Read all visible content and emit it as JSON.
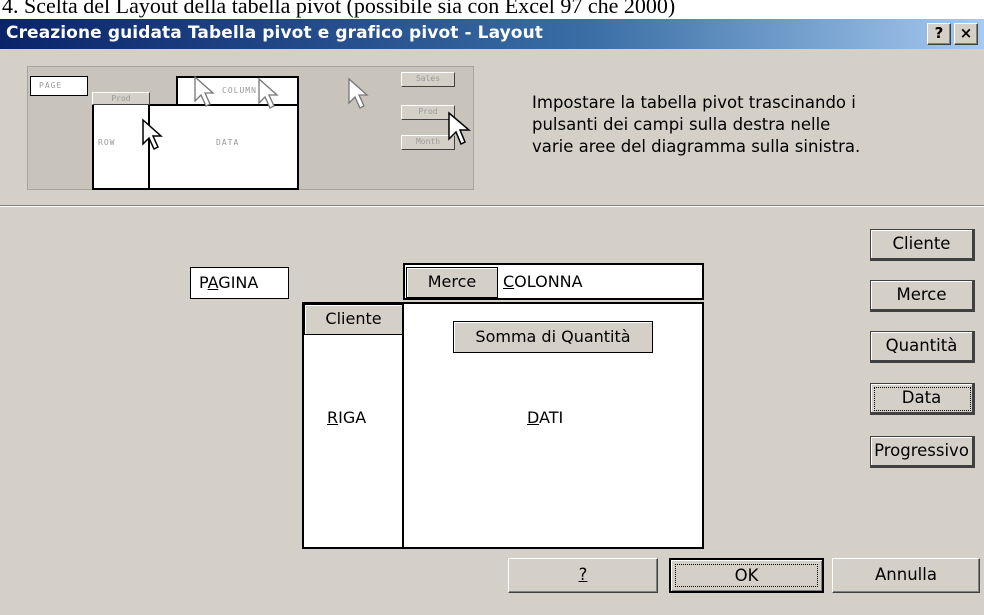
{
  "doc_caption": "4.  Scelta del Layout della tabella pivot (possibile sia con Excel 97 che 2000)",
  "dialog": {
    "title": "Creazione guidata Tabella pivot e grafico pivot - Layout",
    "help_button": "?",
    "close_button": "×"
  },
  "preview": {
    "page": "PAGE",
    "column": "COLUMN",
    "row": "ROW",
    "data": "DATA",
    "prod_drag": "Prod",
    "buttons": [
      "Sales",
      "Prod",
      "Month"
    ]
  },
  "instructions": [
    "Impostare la tabella pivot trascinando i",
    "pulsanti dei campi sulla destra nelle",
    "varie aree del diagramma sulla sinistra."
  ],
  "layout": {
    "page_pre": "P",
    "page_key": "A",
    "page_post": "GINA",
    "column_key": "C",
    "column_post": "OLONNA",
    "row_key": "R",
    "row_post": "IGA",
    "data_key": "D",
    "data_post": "ATI",
    "column_field": "Merce",
    "row_field": "Cliente",
    "data_field": "Somma di Quantità"
  },
  "field_buttons": [
    "Cliente",
    "Merce",
    "Quantità",
    "Data",
    "Progressivo"
  ],
  "footer": {
    "help": "?",
    "ok": "OK",
    "cancel": "Annulla"
  }
}
